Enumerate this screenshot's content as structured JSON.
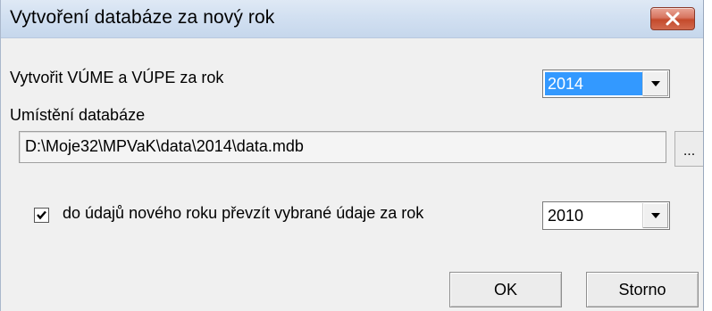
{
  "window": {
    "title": "Vytvoření databáze za nový rok",
    "close_icon": "close-icon"
  },
  "year_create": {
    "label": "Vytvořit VÚME a VÚPE za rok",
    "selected": "2014"
  },
  "location": {
    "label": "Umístění databáze",
    "path": "D:\\Moje32\\MPVaK\\data\\2014\\data.mdb",
    "browse_label": "..."
  },
  "transfer": {
    "checked": true,
    "label": "do údajů nového roku převzít vybrané údaje za rok",
    "selected": "2010"
  },
  "buttons": {
    "ok": "OK",
    "cancel": "Storno"
  },
  "colors": {
    "selection": "#3399ff",
    "dialog_bg": "#f0f0f0",
    "close_button": "#c44a2c"
  }
}
